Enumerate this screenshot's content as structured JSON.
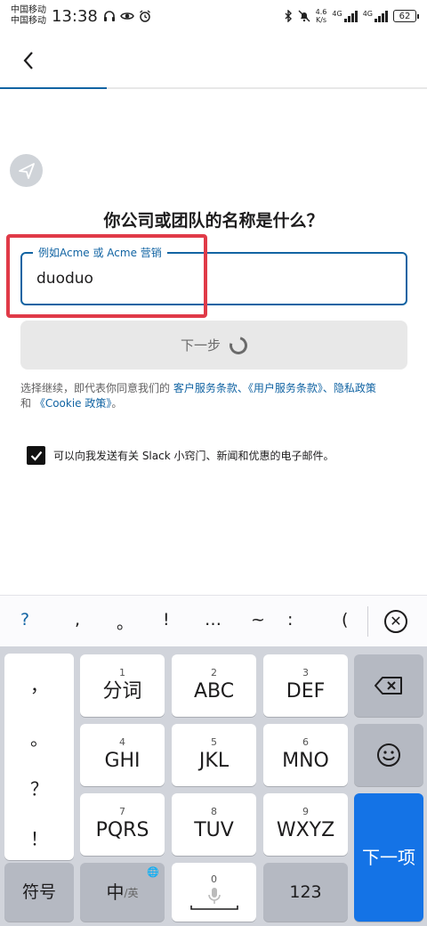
{
  "status_bar": {
    "carrier1": "中国移动",
    "carrier2": "中国移动",
    "time": "13:38",
    "net_speed_value": "4.6",
    "net_speed_unit": "K/s",
    "signal1": "4G",
    "signal2": "4G",
    "battery": "62"
  },
  "progress": {
    "fraction": 0.25,
    "color": "#1264a3"
  },
  "page": {
    "question": "你公司或团队的名称是什么？",
    "input_legend": "例如Acme 或 Acme 营销",
    "input_value": "duoduo",
    "next_button": "下一步",
    "terms_prefix": "选择继续，即代表你同意我们的 ",
    "terms_link1": "客户服务条款",
    "terms_mid1": "、",
    "terms_link2": "《用户服务条款》",
    "terms_mid2": "、",
    "terms_link3": "隐私政策",
    "terms_and": "和 ",
    "terms_link4": "《Cookie 政策》",
    "terms_end": "。",
    "consent": "可以向我发送有关 Slack 小窍门、新闻和优惠的电子邮件。",
    "consent_checked": true
  },
  "keyboard": {
    "suggestions": [
      "?",
      ",",
      "。",
      "!",
      "…",
      "~",
      ":",
      "("
    ],
    "left_column": [
      "，",
      "。",
      "？",
      "！"
    ],
    "keys_row1": [
      {
        "num": "1",
        "label": "分词"
      },
      {
        "num": "2",
        "label": "ABC"
      },
      {
        "num": "3",
        "label": "DEF"
      }
    ],
    "keys_row2": [
      {
        "num": "4",
        "label": "GHI"
      },
      {
        "num": "5",
        "label": "JKL"
      },
      {
        "num": "6",
        "label": "MNO"
      }
    ],
    "keys_row3": [
      {
        "num": "7",
        "label": "PQRS"
      },
      {
        "num": "8",
        "label": "TUV"
      },
      {
        "num": "9",
        "label": "WXYZ"
      }
    ],
    "symbol_key": "符号",
    "lang_key_main": "中",
    "lang_key_sub": "/英",
    "space_num": "0",
    "num_key": "123",
    "enter_key": "下一项"
  },
  "colors": {
    "accent": "#1264a3",
    "highlight": "#e03a48",
    "enter": "#1473e6"
  }
}
